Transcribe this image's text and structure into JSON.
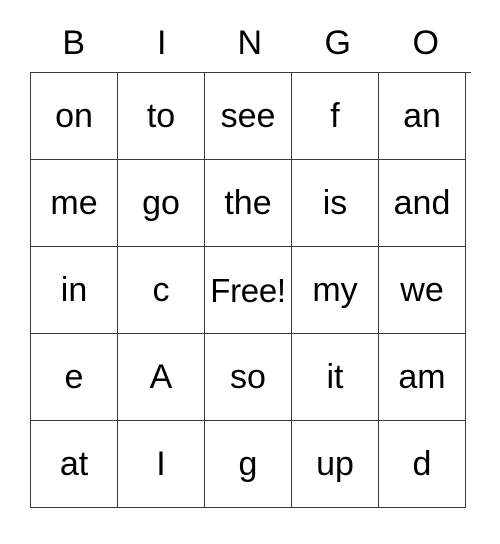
{
  "card": {
    "title": "BINGO",
    "headers": [
      "B",
      "I",
      "N",
      "G",
      "O"
    ],
    "free_space": "Free!",
    "colors": {
      "border": "#3a3a3a",
      "text": "#000000",
      "background": "#ffffff"
    },
    "rows": [
      {
        "cells": [
          "on",
          "to",
          "see",
          "f",
          "an"
        ]
      },
      {
        "cells": [
          "me",
          "go",
          "the",
          "is",
          "and"
        ]
      },
      {
        "cells": [
          "in",
          "c",
          "Free!",
          "my",
          "we"
        ]
      },
      {
        "cells": [
          "e",
          "A",
          "so",
          "it",
          "am"
        ]
      },
      {
        "cells": [
          "at",
          "I",
          "g",
          "up",
          "d"
        ]
      }
    ]
  }
}
